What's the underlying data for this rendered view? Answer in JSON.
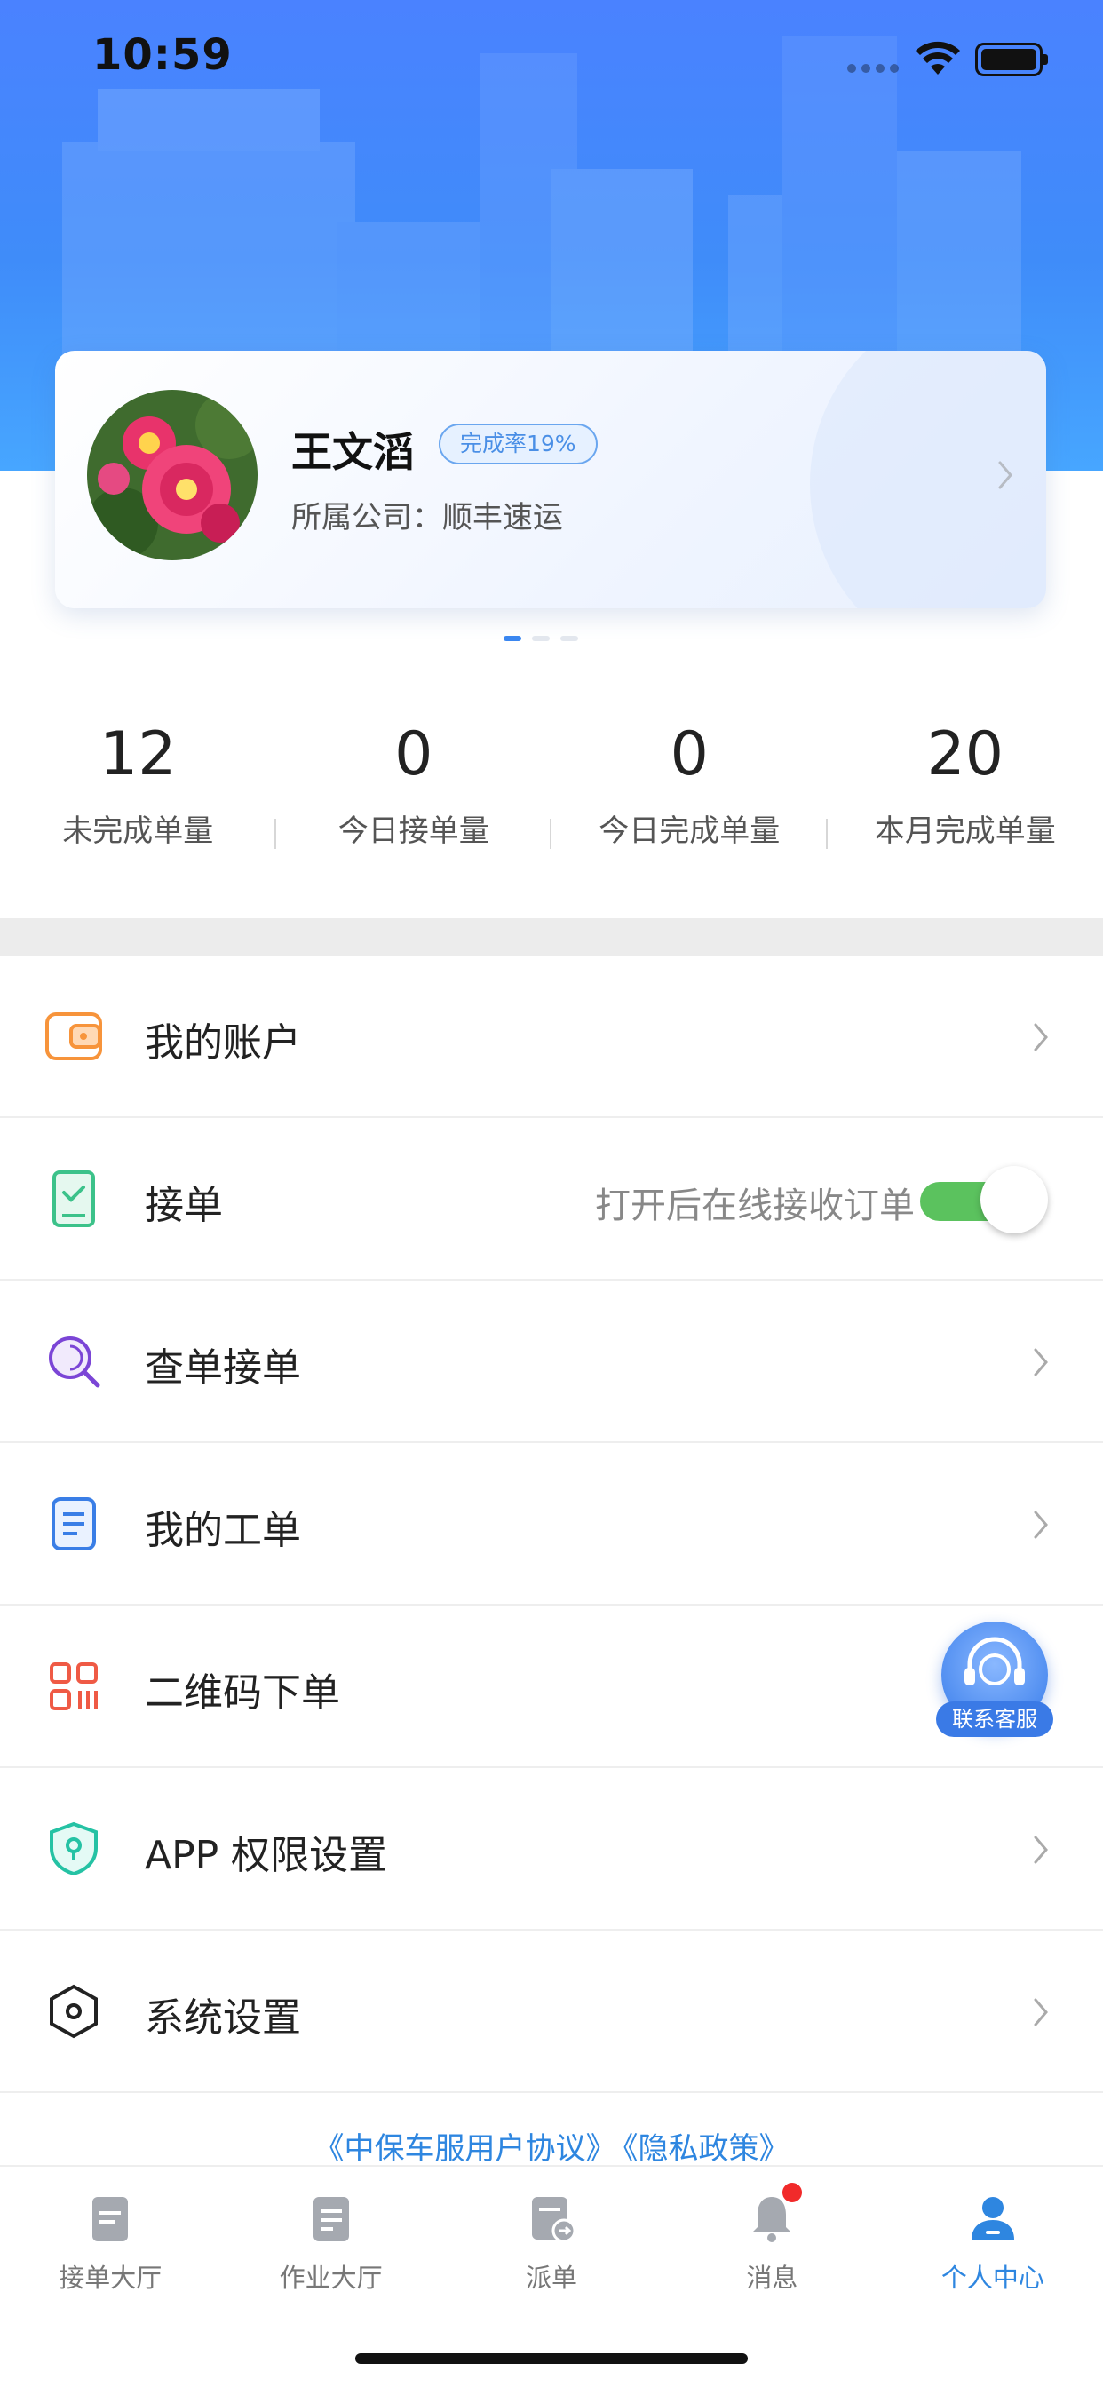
{
  "status_bar": {
    "time": "10:59"
  },
  "profile": {
    "name": "王文滔",
    "completion_rate_label": "完成率19%",
    "company_label": "所属公司：顺丰速运"
  },
  "stats": [
    {
      "value": "12",
      "label": "未完成单量"
    },
    {
      "value": "0",
      "label": "今日接单量"
    },
    {
      "value": "0",
      "label": "今日完成单量"
    },
    {
      "value": "20",
      "label": "本月完成单量"
    }
  ],
  "menu": {
    "items": [
      {
        "label": "我的账户",
        "icon": "wallet-icon"
      },
      {
        "label": "接单",
        "icon": "order-tablet-icon",
        "hint": "打开后在线接收订单",
        "toggle_on": true
      },
      {
        "label": "查单接单",
        "icon": "search-icon"
      },
      {
        "label": "我的工单",
        "icon": "document-icon"
      },
      {
        "label": "二维码下单",
        "icon": "qr-code-icon"
      },
      {
        "label": "APP 权限设置",
        "icon": "shield-icon"
      },
      {
        "label": "系统设置",
        "icon": "hexagon-settings-icon"
      }
    ]
  },
  "service_button": {
    "label": "联系客服"
  },
  "agreement": {
    "user_agreement": "《中保车服用户协议》",
    "privacy_policy": "《隐私政策》"
  },
  "tabbar": {
    "tabs": [
      {
        "label": "接单大厅",
        "icon": "order-hall-icon"
      },
      {
        "label": "作业大厅",
        "icon": "work-hall-icon"
      },
      {
        "label": "派单",
        "icon": "dispatch-icon"
      },
      {
        "label": "消息",
        "icon": "bell-icon",
        "has_badge": true
      },
      {
        "label": "个人中心",
        "icon": "user-icon",
        "active": true
      }
    ]
  },
  "colors": {
    "header_blue": "#4a82ff",
    "accent_blue": "#2e86e0",
    "toggle_green": "#5bc25e",
    "badge_red": "#f12a2a"
  }
}
